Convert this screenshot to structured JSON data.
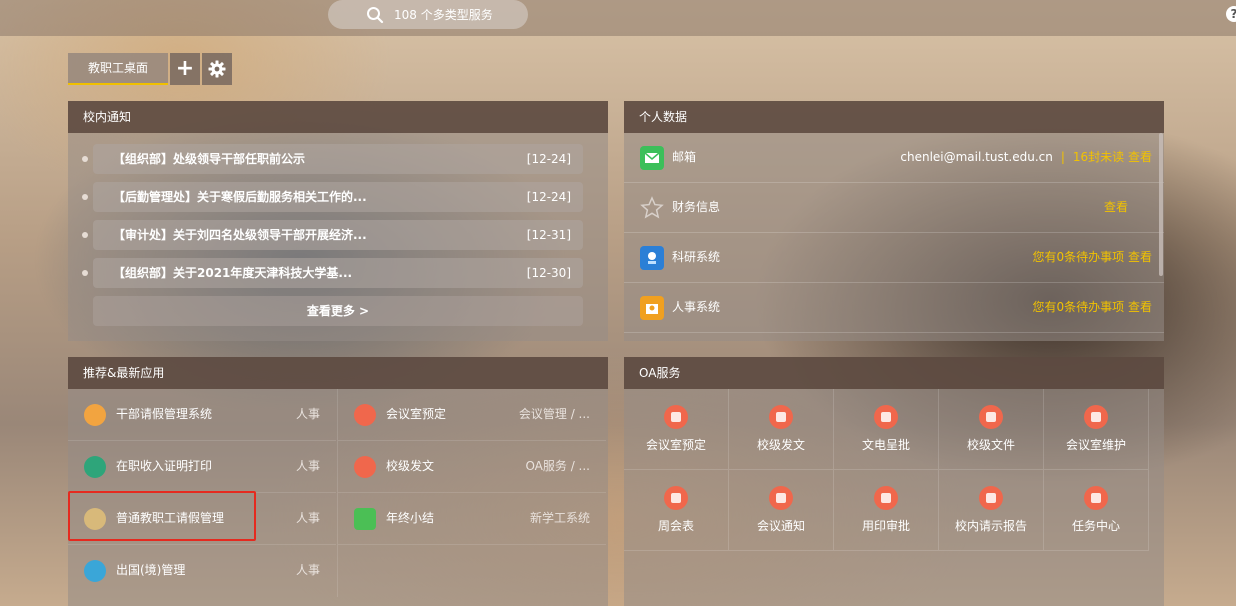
{
  "top": {
    "search_placeholder": "108 个多类型服务",
    "help": "?"
  },
  "tabs": {
    "active": "教职工桌面",
    "add": "+"
  },
  "notices": {
    "title": "校内通知",
    "items": [
      {
        "text": "【组织部】处级领导干部任职前公示",
        "date": "[12-24]"
      },
      {
        "text": "【后勤管理处】关于寒假后勤服务相关工作的...",
        "date": "[12-24]"
      },
      {
        "text": "【审计处】关于刘四名处级领导干部开展经济...",
        "date": "[12-31]"
      },
      {
        "text": "【组织部】关于2021年度天津科技大学基...",
        "date": "[12-30]"
      }
    ],
    "more": "查看更多 >"
  },
  "personal": {
    "title": "个人数据",
    "rows": [
      {
        "label": "邮箱",
        "email": "chenlei@mail.tust.edu.cn",
        "sep": "|",
        "action": "16封未读 查看",
        "icon_color": "#3cbf5a"
      },
      {
        "label": "财务信息",
        "action": "查看",
        "icon_color": "#bdb6b0"
      },
      {
        "label": "科研系统",
        "action": "您有0条待办事项 查看",
        "icon_color": "#2b7fd6"
      },
      {
        "label": "人事系统",
        "action": "您有0条待办事项 查看",
        "icon_color": "#f0a020"
      }
    ]
  },
  "apps": {
    "title": "推荐&最新应用",
    "left": [
      {
        "label": "干部请假管理系统",
        "cat": "人事",
        "icon_color": "#f2a440"
      },
      {
        "label": "在职收入证明打印",
        "cat": "人事",
        "icon_color": "#2ea57a"
      },
      {
        "label": "普通教职工请假管理",
        "cat": "人事",
        "icon_color": "#d8b97a"
      },
      {
        "label": "出国(境)管理",
        "cat": "人事",
        "icon_color": "#3aa6d8"
      }
    ],
    "right": [
      {
        "label": "会议室预定",
        "cat": "会议管理 / ...",
        "icon_color": "#f0674c"
      },
      {
        "label": "校级发文",
        "cat": "OA服务 / ...",
        "icon_color": "#f0674c"
      },
      {
        "label": "年终小结",
        "cat": "新学工系统",
        "icon_color": "#4bbf55"
      }
    ]
  },
  "oa": {
    "title": "OA服务",
    "items": [
      "会议室预定",
      "校级发文",
      "文电呈批",
      "校级文件",
      "会议室维护",
      "周会表",
      "会议通知",
      "用印审批",
      "校内请示报告",
      "任务中心"
    ]
  }
}
